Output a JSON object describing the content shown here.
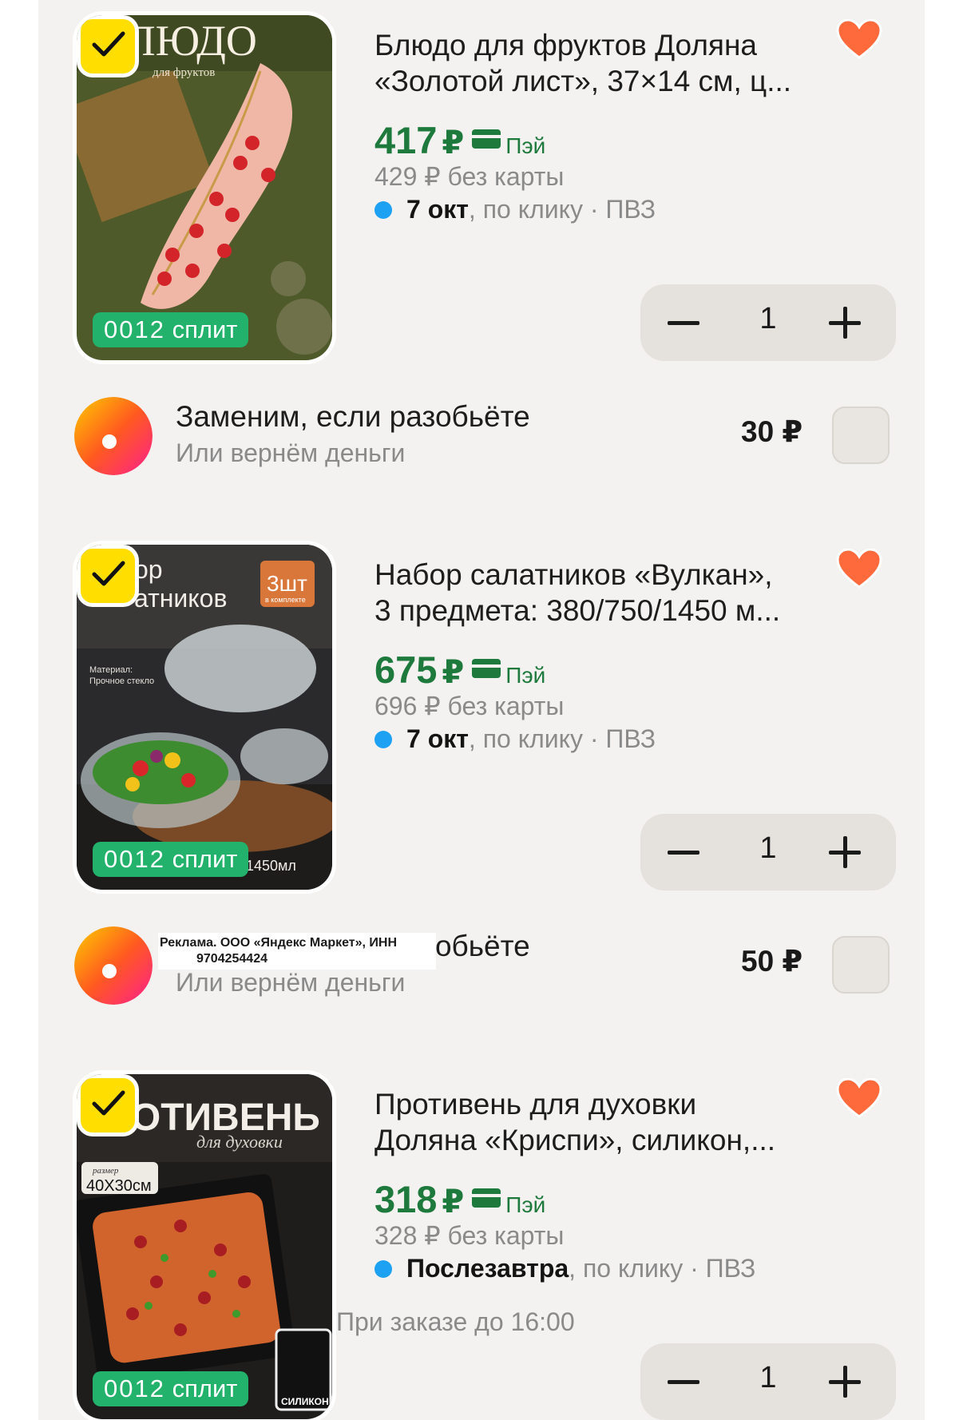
{
  "products": [
    {
      "title_line1": "Блюдо для фруктов Доляна",
      "title_line2": "«Золотой лист», 37×14 см, ц...",
      "price": "417",
      "currency": "₽",
      "pay_label": "Пэй",
      "old_price": "429 ₽  без карты",
      "delivery_date": "7 окт",
      "delivery_rest": ", по клику · ПВЗ",
      "split_num": "0012",
      "split_label": "сплит",
      "quantity": "1",
      "image_caption": "ЛЮДО",
      "image_sub": "для фруктов",
      "favorited": true
    },
    {
      "title_line1": "Набор салатников «Вулкан»,",
      "title_line2": "3 предмета: 380/750/1450 м...",
      "price": "675",
      "currency": "₽",
      "pay_label": "Пэй",
      "old_price": "696 ₽  без карты",
      "delivery_date": "7 окт",
      "delivery_rest": ", по клику · ПВЗ",
      "split_num": "0012",
      "split_label": "сплит",
      "quantity": "1",
      "image_caption_1": "ор",
      "image_caption_2": "атников",
      "image_tag": "3шт",
      "image_tag_sub": "в комплекте",
      "image_material": "Материал:",
      "image_material_2": "Прочное стекло",
      "image_volume": "1450мл",
      "favorited": true
    },
    {
      "title_line1": "Противень для духовки",
      "title_line2": "Доляна «Криспи», силикон,...",
      "price": "318",
      "currency": "₽",
      "pay_label": "Пэй",
      "old_price": "328 ₽  без карты",
      "delivery_date": "Послезавтра",
      "delivery_rest": ", по клику · ПВЗ",
      "order_note": "При заказе до 16:00",
      "split_num": "0012",
      "split_label": "сплит",
      "quantity": "1",
      "image_caption": "ПРОТИВЕНЬ",
      "image_sub": "для духовки",
      "image_size_label": "размер",
      "image_size": "40X30см",
      "image_material": "СИЛИКОН",
      "favorited": true
    }
  ],
  "protections": [
    {
      "title": "Заменим, если разобьёте",
      "subtitle": "Или вернём деньги",
      "price": "30 ₽",
      "checked": false
    },
    {
      "title": "Заменим, если разобьёте",
      "subtitle": "Или вернём деньги",
      "price": "50 ₽",
      "checked": false
    }
  ],
  "ad_notice": {
    "line1": "Реклама. ООО «Яндекс Маркет», ИНН",
    "line2": "9704254424"
  },
  "colors": {
    "price_green": "#1e7a3c",
    "split_green": "#22b26b",
    "check_yellow": "#ffde00",
    "heart": "#ff6a3d",
    "delivery_dot": "#1da1f2"
  },
  "icons": {
    "check": "check-icon",
    "heart": "heart-icon",
    "pay": "card-icon",
    "minus": "minus-icon",
    "plus": "plus-icon",
    "protection_logo": "yandex-protection-logo"
  }
}
